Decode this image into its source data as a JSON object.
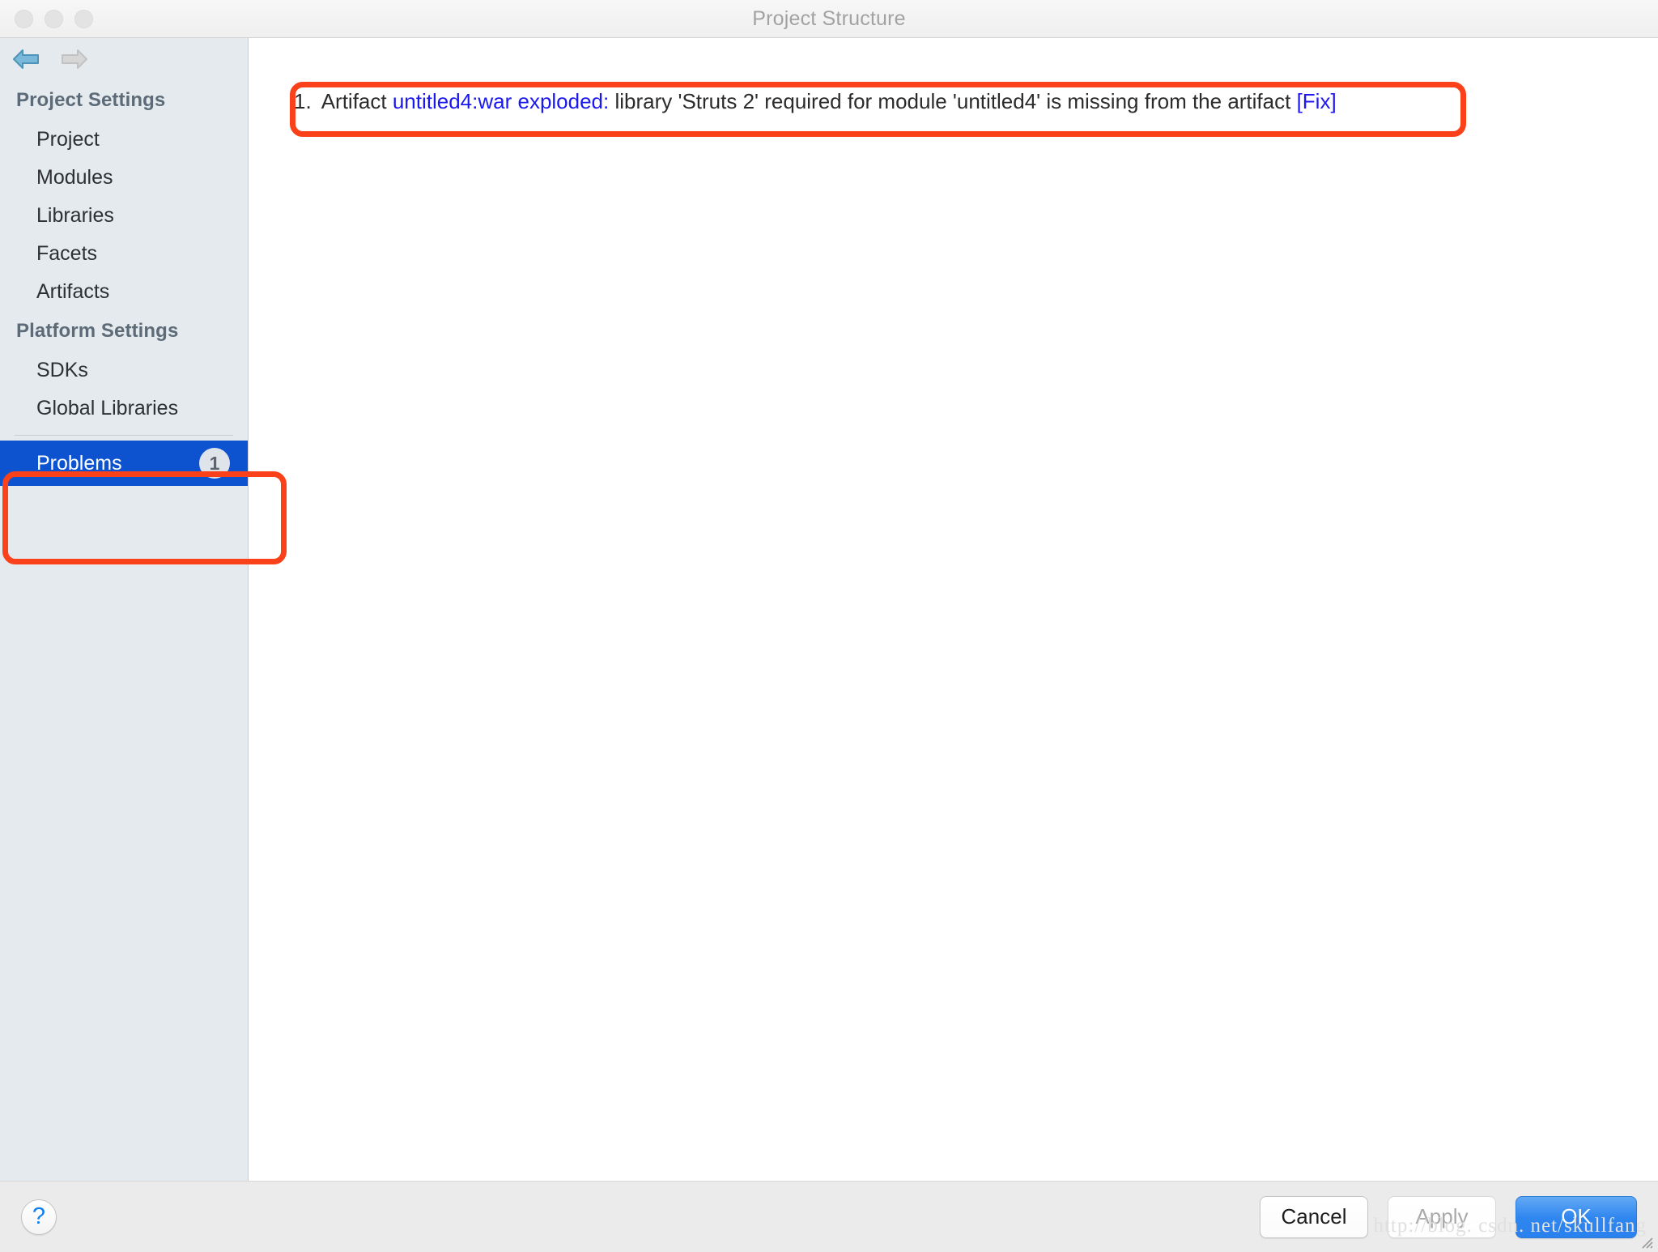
{
  "window": {
    "title": "Project Structure",
    "traffic_lights": [
      "close",
      "minimize",
      "zoom"
    ]
  },
  "sidebar": {
    "nav": {
      "back_label": "Back",
      "forward_label": "Forward"
    },
    "groups": [
      {
        "header": "Project Settings",
        "items": [
          {
            "label": "Project",
            "selected": false
          },
          {
            "label": "Modules",
            "selected": false
          },
          {
            "label": "Libraries",
            "selected": false
          },
          {
            "label": "Facets",
            "selected": false
          },
          {
            "label": "Artifacts",
            "selected": false
          }
        ]
      },
      {
        "header": "Platform Settings",
        "items": [
          {
            "label": "SDKs",
            "selected": false
          },
          {
            "label": "Global Libraries",
            "selected": false
          }
        ]
      }
    ],
    "problems": {
      "label": "Problems",
      "badge_count": "1",
      "selected": true
    }
  },
  "content": {
    "problem": {
      "index": "1.",
      "prefix": "Artifact",
      "artifact_link": "untitled4:war exploded:",
      "message": "library 'Struts 2' required for module 'untitled4' is missing from the artifact",
      "fix_link": "[Fix]"
    }
  },
  "footer": {
    "help_label": "?",
    "cancel_label": "Cancel",
    "apply_label": "Apply",
    "ok_label": "OK",
    "watermark": "http://blog. csdn. net/skullfang"
  },
  "colors": {
    "selection_blue": "#0d53d0",
    "link_blue": "#1a18f0",
    "annotation_red": "#fa4119",
    "ok_button_blue": "#2f86ef",
    "sidebar_bg": "#e4eaed"
  }
}
